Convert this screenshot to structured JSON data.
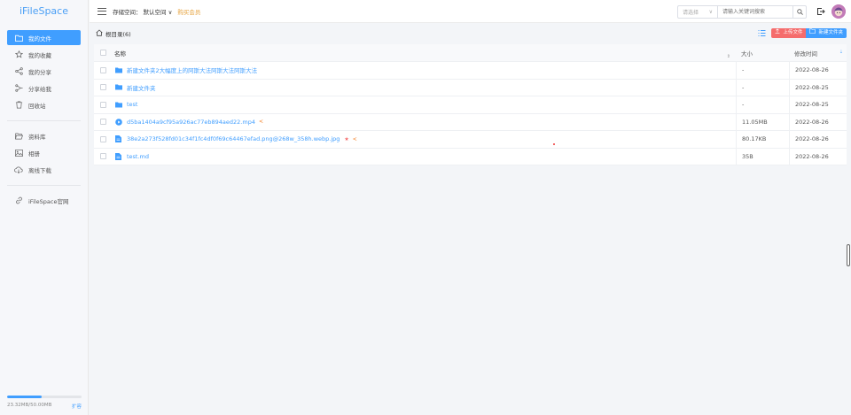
{
  "app": {
    "logo": "iFileSpace"
  },
  "sidebar": {
    "items": [
      {
        "label": "我的文件",
        "icon": "folder-icon",
        "active": true
      },
      {
        "label": "我的收藏",
        "icon": "star-icon"
      },
      {
        "label": "我的分享",
        "icon": "share-icon"
      },
      {
        "label": "分享给我",
        "icon": "share-received-icon"
      },
      {
        "label": "回收站",
        "icon": "trash-icon"
      }
    ],
    "items2": [
      {
        "label": "资料库",
        "icon": "folder-open-icon"
      },
      {
        "label": "相册",
        "icon": "image-icon"
      },
      {
        "label": "离线下载",
        "icon": "cloud-download-icon"
      }
    ],
    "items3": [
      {
        "label": "iFileSpace官网",
        "icon": "link-icon"
      }
    ],
    "storage": {
      "used_text": "23.32MB/50.00MB",
      "expand_label": "扩容",
      "used_fraction": 0.466
    }
  },
  "header": {
    "space_label": "存储空间：",
    "space_value": "默认空间 ∨",
    "buy_vip": "购买会员",
    "select_placeholder": "请选择",
    "search_placeholder": "请输入关键词搜索"
  },
  "toolbar": {
    "breadcrumb": "根目录(6)",
    "upload_label": "上传文件",
    "new_folder_label": "新建文件夹"
  },
  "table": {
    "headers": {
      "name": "名称",
      "size": "大小",
      "time": "修改时间"
    },
    "rows": [
      {
        "type": "folder",
        "name": "新建文件夹2大幅度上的阿斯大法阿斯大法阿斯大法",
        "size": "-",
        "time": "2022-08-26"
      },
      {
        "type": "folder",
        "name": "新建文件夹",
        "size": "-",
        "time": "2022-08-25"
      },
      {
        "type": "folder",
        "name": "test",
        "size": "-",
        "time": "2022-08-25"
      },
      {
        "type": "video",
        "name": "d5ba1404a9cf95a926ac77eb894aed22.mp4",
        "size": "11.05MB",
        "time": "2022-08-26",
        "shared": true
      },
      {
        "type": "file",
        "name": "38e2a273f528fd01c34f1fc4df0f69c64467efad.png@268w_358h.webp.jpg",
        "size": "80.17KB",
        "time": "2022-08-26",
        "starred": true,
        "shared": true
      },
      {
        "type": "file",
        "name": "test.md",
        "size": "35B",
        "time": "2022-08-26"
      }
    ]
  }
}
